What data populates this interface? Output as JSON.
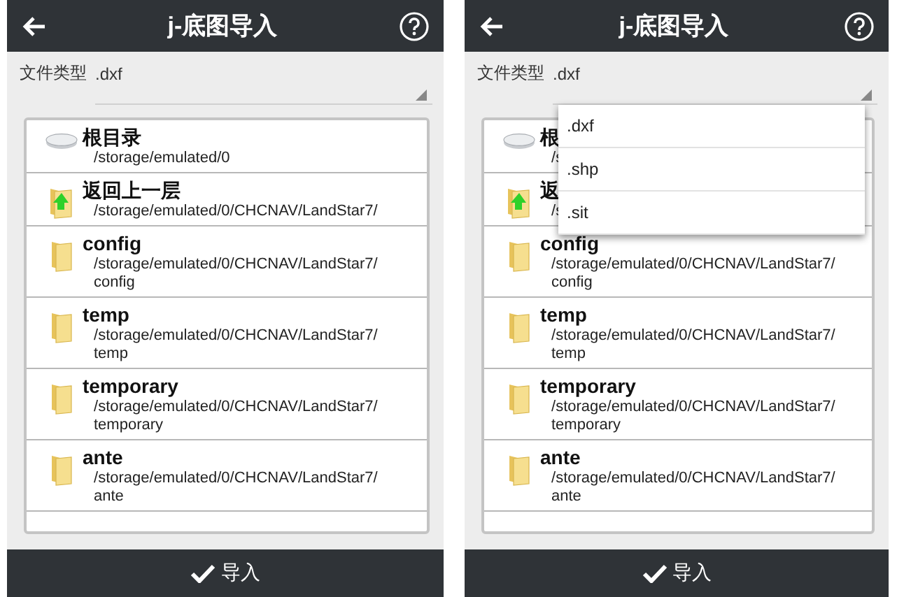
{
  "screens": [
    {
      "title": "j-底图导入",
      "file_type": {
        "label": "文件类型",
        "value": ".dxf"
      },
      "items": [
        {
          "kind": "drive",
          "name": "根目录",
          "path": "/storage/emulated/0"
        },
        {
          "kind": "up",
          "name": "返回上一层",
          "path": "/storage/emulated/0/CHCNAV/LandStar7/"
        },
        {
          "kind": "folder",
          "name": "config",
          "path": "/storage/emulated/0/CHCNAV/LandStar7/config"
        },
        {
          "kind": "folder",
          "name": "temp",
          "path": "/storage/emulated/0/CHCNAV/LandStar7/temp"
        },
        {
          "kind": "folder",
          "name": "temporary",
          "path": "/storage/emulated/0/CHCNAV/LandStar7/temporary"
        },
        {
          "kind": "folder",
          "name": "ante",
          "path": "/storage/emulated/0/CHCNAV/LandStar7/ante"
        }
      ],
      "import_button": "导入"
    },
    {
      "title": "j-底图导入",
      "file_type": {
        "label": "文件类型",
        "value": ".dxf"
      },
      "dropdown": {
        "expanded": true,
        "options": [
          {
            "label": ".dxf"
          },
          {
            "label": ".shp"
          },
          {
            "label": ".sit"
          }
        ]
      },
      "items": [
        {
          "kind": "drive",
          "name": "根",
          "path": "/s"
        },
        {
          "kind": "up",
          "name": "返",
          "path": "/s"
        },
        {
          "kind": "folder",
          "name": "config",
          "path": "/storage/emulated/0/CHCNAV/LandStar7/config"
        },
        {
          "kind": "folder",
          "name": "temp",
          "path": "/storage/emulated/0/CHCNAV/LandStar7/temp"
        },
        {
          "kind": "folder",
          "name": "temporary",
          "path": "/storage/emulated/0/CHCNAV/LandStar7/temporary"
        },
        {
          "kind": "folder",
          "name": "ante",
          "path": "/storage/emulated/0/CHCNAV/LandStar7/ante"
        }
      ],
      "import_button": "导入"
    }
  ]
}
